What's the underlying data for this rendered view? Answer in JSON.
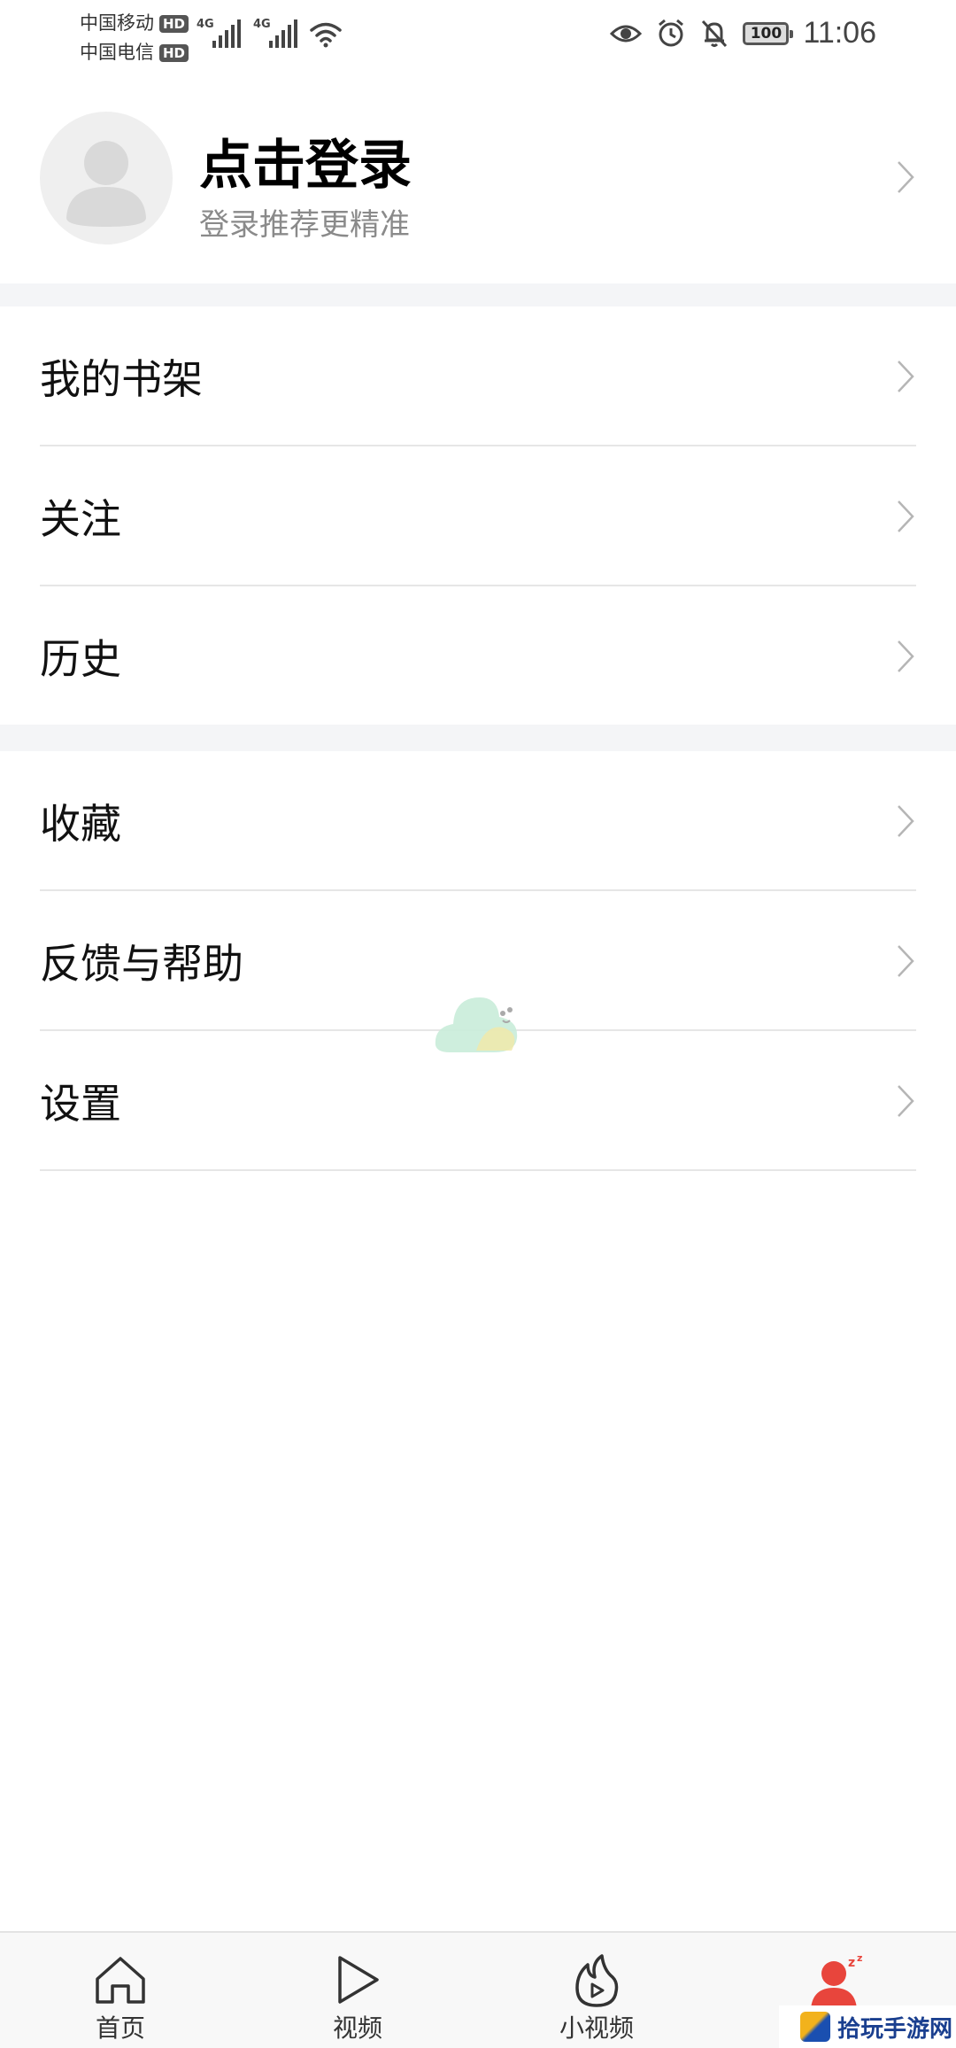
{
  "status_bar": {
    "carrier1": "中国移动",
    "carrier2": "中国电信",
    "hd": "HD",
    "network": "4G",
    "battery": "100",
    "time": "11:06"
  },
  "profile": {
    "title": "点击登录",
    "subtitle": "登录推荐更精准"
  },
  "menu": {
    "group1": [
      {
        "label": "我的书架"
      },
      {
        "label": "关注"
      },
      {
        "label": "历史"
      }
    ],
    "group2": [
      {
        "label": "收藏"
      },
      {
        "label": "反馈与帮助"
      },
      {
        "label": "设置"
      }
    ]
  },
  "bottom_nav": {
    "items": [
      {
        "label": "首页",
        "icon": "home-icon"
      },
      {
        "label": "视频",
        "icon": "play-icon"
      },
      {
        "label": "小视频",
        "icon": "flame-play-icon"
      },
      {
        "label": "",
        "icon": "profile-sleep-icon",
        "active": true
      }
    ]
  },
  "watermark": {
    "brand": "拾玩手游网"
  },
  "colors": {
    "accent": "#e8453c",
    "background_band": "#f4f5f7",
    "text_secondary": "#8a8a8a"
  }
}
